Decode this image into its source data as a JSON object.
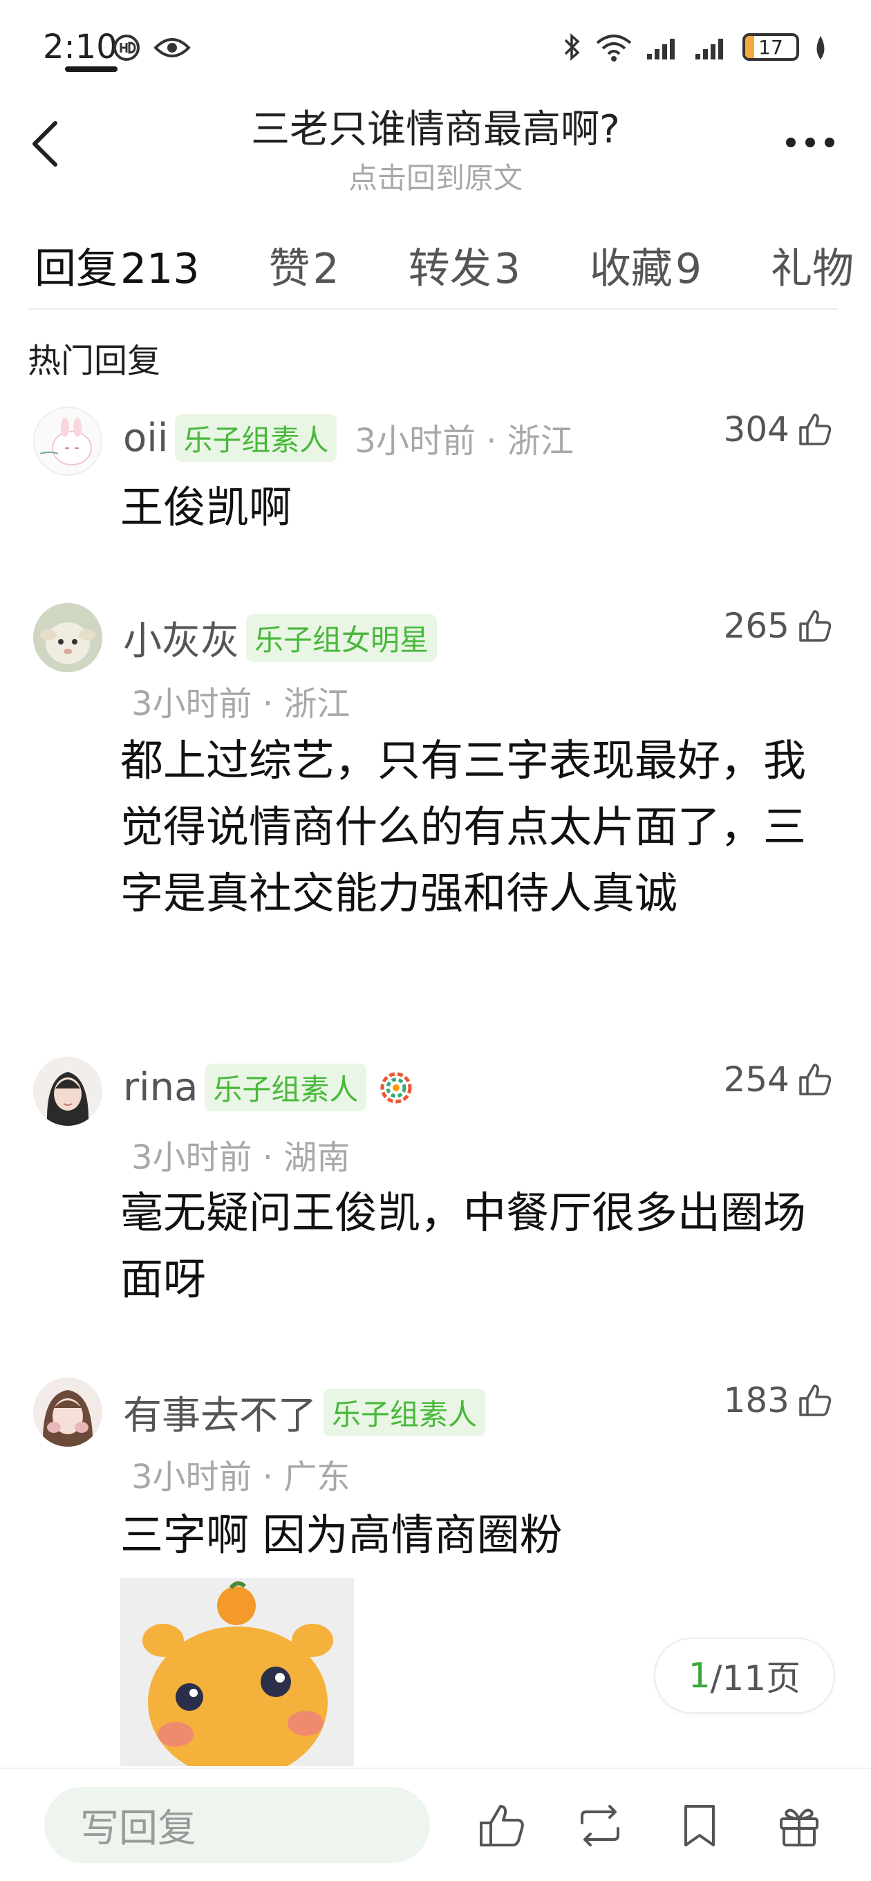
{
  "status_bar": {
    "time": "2:10",
    "battery": "17",
    "battery_level_percent": 17
  },
  "header": {
    "title": "三老只谁情商最高啊?",
    "subtitle": "点击回到原文"
  },
  "tabs": [
    {
      "label": "回复",
      "count": "213"
    },
    {
      "label": "赞",
      "count": "2"
    },
    {
      "label": "转发",
      "count": "3"
    },
    {
      "label": "收藏",
      "count": "9"
    },
    {
      "label": "礼物",
      "count": ""
    }
  ],
  "section_title": "热门回复",
  "comments": [
    {
      "username": "oii",
      "badge": "乐子组素人",
      "time_loc": "3小时前 · 浙江",
      "likes": "304",
      "text": "王俊凯啊"
    },
    {
      "username": "小灰灰",
      "badge": "乐子组女明星",
      "time_loc": "3小时前 · 浙江",
      "likes": "265",
      "text": "都上过综艺，只有三字表现最好，我觉得说情商什么的有点太片面了，三字是真社交能力强和待人真诚"
    },
    {
      "username": "rina",
      "badge": "乐子组素人",
      "time_loc": "3小时前 · 湖南",
      "likes": "254",
      "text": "毫无疑问王俊凯，中餐厅很多出圈场面呀"
    },
    {
      "username": "有事去不了",
      "badge": "乐子组素人",
      "time_loc": "3小时前 · 广东",
      "likes": "183",
      "text": "三字啊 因为高情商圈粉"
    }
  ],
  "pager": {
    "current": "1",
    "total_suffix": "/11页"
  },
  "bottom_bar": {
    "reply_placeholder": "写回复"
  },
  "colors": {
    "badge_green": "#48b83b",
    "badge_bg": "#eaf6e5",
    "pager_green": "#3aa53a"
  }
}
